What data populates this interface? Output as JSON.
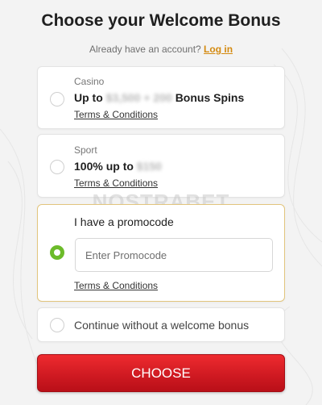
{
  "header": {
    "title": "Choose your Welcome Bonus",
    "account_prompt": "Already have an account?",
    "login_link": "Log in"
  },
  "options": {
    "casino": {
      "category": "Casino",
      "headline_prefix": "Up to",
      "headline_blurred": "$3,500 + 200",
      "headline_suffix": "Bonus Spins",
      "terms": "Terms & Conditions"
    },
    "sport": {
      "category": "Sport",
      "headline_prefix": "100% up to",
      "headline_blurred": "$150",
      "terms": "Terms & Conditions"
    },
    "promocode": {
      "label": "I have a promocode",
      "placeholder": "Enter Promocode",
      "value": "",
      "terms": "Terms & Conditions",
      "selected": true
    },
    "no_bonus": {
      "label": "Continue without a welcome bonus"
    }
  },
  "watermark": "NOSTRABET",
  "cta": {
    "label": "CHOOSE"
  },
  "colors": {
    "accent_link": "#d48a10",
    "radio_selected": "#6cbb2a",
    "cta_red": "#d01a22",
    "selected_border": "#e2c57d"
  }
}
